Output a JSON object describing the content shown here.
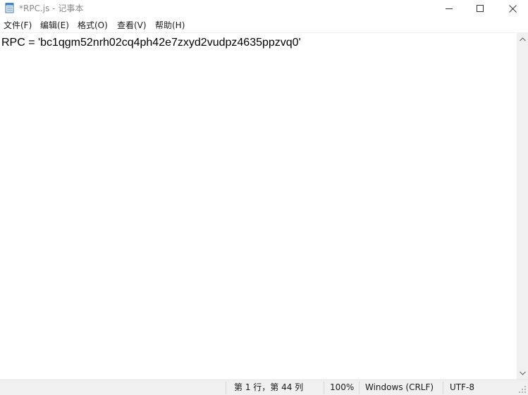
{
  "window": {
    "title": "*RPC.js - 记事本",
    "app_icon": "notepad-icon",
    "controls": {
      "minimize_icon": "minimize-icon",
      "maximize_icon": "maximize-icon",
      "close_icon": "close-icon"
    }
  },
  "menu": {
    "items": [
      {
        "label": "文件(F)"
      },
      {
        "label": "编辑(E)"
      },
      {
        "label": "格式(O)"
      },
      {
        "label": "查看(V)"
      },
      {
        "label": "帮助(H)"
      }
    ]
  },
  "editor": {
    "content": "RPC = 'bc1qgm52nrh02cq4ph42e7zxyd2vudpz4635ppzvq0'"
  },
  "statusbar": {
    "cursor_position": "第 1 行，第 44 列",
    "zoom": "100%",
    "line_ending": "Windows (CRLF)",
    "encoding": "UTF-8"
  },
  "colors": {
    "title_text": "#8a8a8a",
    "statusbar_bg": "#f0f0f0",
    "scrollbar_bg": "#f0f0f0"
  }
}
